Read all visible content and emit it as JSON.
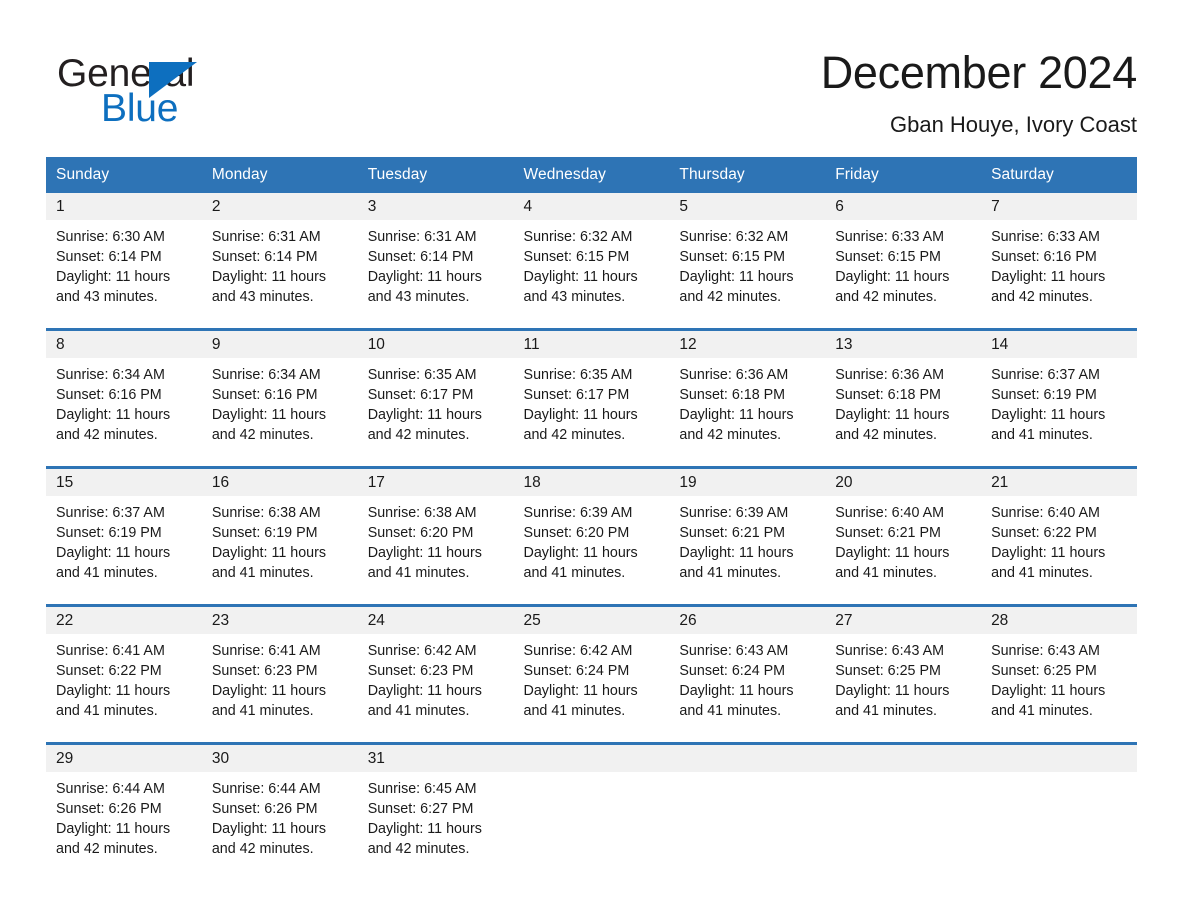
{
  "brand": {
    "logo_text_top": "General",
    "logo_text_bottom": "Blue",
    "logo_icon": "triangle-icon",
    "color_black": "#231f20",
    "color_blue": "#0d6fbf"
  },
  "header": {
    "title": "December 2024",
    "location": "Gban Houye, Ivory Coast"
  },
  "theme": {
    "header_blue": "#2e74b5",
    "daynum_gray": "#f1f1f1",
    "text_color": "#1a1a1a"
  },
  "calendar": {
    "weekday_headers": [
      "Sunday",
      "Monday",
      "Tuesday",
      "Wednesday",
      "Thursday",
      "Friday",
      "Saturday"
    ],
    "weeks": [
      [
        {
          "day": "1",
          "sunrise": "Sunrise: 6:30 AM",
          "sunset": "Sunset: 6:14 PM",
          "daylight": "Daylight: 11 hours and 43 minutes."
        },
        {
          "day": "2",
          "sunrise": "Sunrise: 6:31 AM",
          "sunset": "Sunset: 6:14 PM",
          "daylight": "Daylight: 11 hours and 43 minutes."
        },
        {
          "day": "3",
          "sunrise": "Sunrise: 6:31 AM",
          "sunset": "Sunset: 6:14 PM",
          "daylight": "Daylight: 11 hours and 43 minutes."
        },
        {
          "day": "4",
          "sunrise": "Sunrise: 6:32 AM",
          "sunset": "Sunset: 6:15 PM",
          "daylight": "Daylight: 11 hours and 43 minutes."
        },
        {
          "day": "5",
          "sunrise": "Sunrise: 6:32 AM",
          "sunset": "Sunset: 6:15 PM",
          "daylight": "Daylight: 11 hours and 42 minutes."
        },
        {
          "day": "6",
          "sunrise": "Sunrise: 6:33 AM",
          "sunset": "Sunset: 6:15 PM",
          "daylight": "Daylight: 11 hours and 42 minutes."
        },
        {
          "day": "7",
          "sunrise": "Sunrise: 6:33 AM",
          "sunset": "Sunset: 6:16 PM",
          "daylight": "Daylight: 11 hours and 42 minutes."
        }
      ],
      [
        {
          "day": "8",
          "sunrise": "Sunrise: 6:34 AM",
          "sunset": "Sunset: 6:16 PM",
          "daylight": "Daylight: 11 hours and 42 minutes."
        },
        {
          "day": "9",
          "sunrise": "Sunrise: 6:34 AM",
          "sunset": "Sunset: 6:16 PM",
          "daylight": "Daylight: 11 hours and 42 minutes."
        },
        {
          "day": "10",
          "sunrise": "Sunrise: 6:35 AM",
          "sunset": "Sunset: 6:17 PM",
          "daylight": "Daylight: 11 hours and 42 minutes."
        },
        {
          "day": "11",
          "sunrise": "Sunrise: 6:35 AM",
          "sunset": "Sunset: 6:17 PM",
          "daylight": "Daylight: 11 hours and 42 minutes."
        },
        {
          "day": "12",
          "sunrise": "Sunrise: 6:36 AM",
          "sunset": "Sunset: 6:18 PM",
          "daylight": "Daylight: 11 hours and 42 minutes."
        },
        {
          "day": "13",
          "sunrise": "Sunrise: 6:36 AM",
          "sunset": "Sunset: 6:18 PM",
          "daylight": "Daylight: 11 hours and 42 minutes."
        },
        {
          "day": "14",
          "sunrise": "Sunrise: 6:37 AM",
          "sunset": "Sunset: 6:19 PM",
          "daylight": "Daylight: 11 hours and 41 minutes."
        }
      ],
      [
        {
          "day": "15",
          "sunrise": "Sunrise: 6:37 AM",
          "sunset": "Sunset: 6:19 PM",
          "daylight": "Daylight: 11 hours and 41 minutes."
        },
        {
          "day": "16",
          "sunrise": "Sunrise: 6:38 AM",
          "sunset": "Sunset: 6:19 PM",
          "daylight": "Daylight: 11 hours and 41 minutes."
        },
        {
          "day": "17",
          "sunrise": "Sunrise: 6:38 AM",
          "sunset": "Sunset: 6:20 PM",
          "daylight": "Daylight: 11 hours and 41 minutes."
        },
        {
          "day": "18",
          "sunrise": "Sunrise: 6:39 AM",
          "sunset": "Sunset: 6:20 PM",
          "daylight": "Daylight: 11 hours and 41 minutes."
        },
        {
          "day": "19",
          "sunrise": "Sunrise: 6:39 AM",
          "sunset": "Sunset: 6:21 PM",
          "daylight": "Daylight: 11 hours and 41 minutes."
        },
        {
          "day": "20",
          "sunrise": "Sunrise: 6:40 AM",
          "sunset": "Sunset: 6:21 PM",
          "daylight": "Daylight: 11 hours and 41 minutes."
        },
        {
          "day": "21",
          "sunrise": "Sunrise: 6:40 AM",
          "sunset": "Sunset: 6:22 PM",
          "daylight": "Daylight: 11 hours and 41 minutes."
        }
      ],
      [
        {
          "day": "22",
          "sunrise": "Sunrise: 6:41 AM",
          "sunset": "Sunset: 6:22 PM",
          "daylight": "Daylight: 11 hours and 41 minutes."
        },
        {
          "day": "23",
          "sunrise": "Sunrise: 6:41 AM",
          "sunset": "Sunset: 6:23 PM",
          "daylight": "Daylight: 11 hours and 41 minutes."
        },
        {
          "day": "24",
          "sunrise": "Sunrise: 6:42 AM",
          "sunset": "Sunset: 6:23 PM",
          "daylight": "Daylight: 11 hours and 41 minutes."
        },
        {
          "day": "25",
          "sunrise": "Sunrise: 6:42 AM",
          "sunset": "Sunset: 6:24 PM",
          "daylight": "Daylight: 11 hours and 41 minutes."
        },
        {
          "day": "26",
          "sunrise": "Sunrise: 6:43 AM",
          "sunset": "Sunset: 6:24 PM",
          "daylight": "Daylight: 11 hours and 41 minutes."
        },
        {
          "day": "27",
          "sunrise": "Sunrise: 6:43 AM",
          "sunset": "Sunset: 6:25 PM",
          "daylight": "Daylight: 11 hours and 41 minutes."
        },
        {
          "day": "28",
          "sunrise": "Sunrise: 6:43 AM",
          "sunset": "Sunset: 6:25 PM",
          "daylight": "Daylight: 11 hours and 41 minutes."
        }
      ],
      [
        {
          "day": "29",
          "sunrise": "Sunrise: 6:44 AM",
          "sunset": "Sunset: 6:26 PM",
          "daylight": "Daylight: 11 hours and 42 minutes."
        },
        {
          "day": "30",
          "sunrise": "Sunrise: 6:44 AM",
          "sunset": "Sunset: 6:26 PM",
          "daylight": "Daylight: 11 hours and 42 minutes."
        },
        {
          "day": "31",
          "sunrise": "Sunrise: 6:45 AM",
          "sunset": "Sunset: 6:27 PM",
          "daylight": "Daylight: 11 hours and 42 minutes."
        },
        {
          "day": "",
          "sunrise": "",
          "sunset": "",
          "daylight": ""
        },
        {
          "day": "",
          "sunrise": "",
          "sunset": "",
          "daylight": ""
        },
        {
          "day": "",
          "sunrise": "",
          "sunset": "",
          "daylight": ""
        },
        {
          "day": "",
          "sunrise": "",
          "sunset": "",
          "daylight": ""
        }
      ]
    ]
  }
}
